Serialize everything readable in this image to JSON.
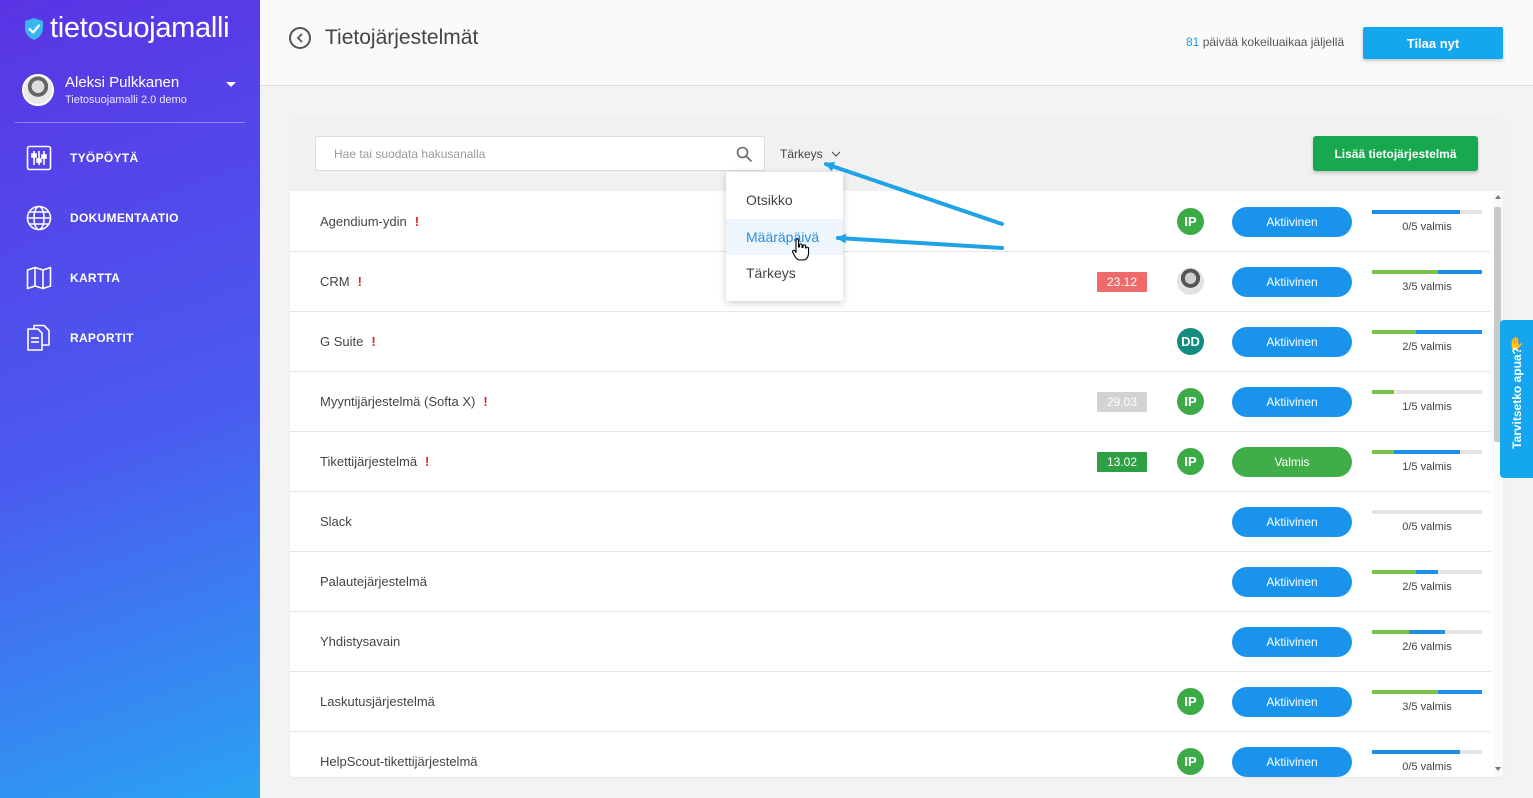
{
  "app": {
    "logo_text": "tietosuojamalli"
  },
  "user": {
    "name": "Aleksi Pulkkanen",
    "org": "Tietosuojamalli 2.0 demo"
  },
  "nav": [
    {
      "label": "TYÖPÖYTÄ",
      "icon": "sliders-icon"
    },
    {
      "label": "DOKUMENTAATIO",
      "icon": "globe-icon"
    },
    {
      "label": "KARTTA",
      "icon": "map-icon"
    },
    {
      "label": "RAPORTIT",
      "icon": "documents-icon"
    }
  ],
  "header": {
    "title": "Tietojärjestelmät",
    "trial_days": "81",
    "trial_text": " päivää kokeiluaikaa jäljellä",
    "order_label": "Tilaa nyt"
  },
  "toolbar": {
    "search_placeholder": "Hae tai suodata hakusanalla",
    "sort_label": "Tärkeys",
    "add_label": "Lisää tietojärjestelmä"
  },
  "dropdown": {
    "options": [
      "Otsikko",
      "Määräpäivä",
      "Tärkeys"
    ],
    "hovered_index": 1
  },
  "colors": {
    "status_active": "#1a93ec",
    "status_done": "#3fae49",
    "date_overdue": "#ef6b6b",
    "date_past": "#d3d3d3",
    "date_ok": "#2ea043",
    "avatar_ip": "#3daa48",
    "avatar_dd": "#128c7e"
  },
  "rows": [
    {
      "name": "Agendium-ydin",
      "important": true,
      "date": "",
      "date_kind": "",
      "assignee": "IP",
      "assignee_kind": "ip",
      "status": "Aktiivinen",
      "status_kind": "active",
      "progress_done": 0,
      "progress_started": 0.8,
      "progress_label": "0/5 valmis"
    },
    {
      "name": "CRM",
      "important": true,
      "date": "23.12",
      "date_kind": "overdue",
      "assignee": "",
      "assignee_kind": "photo",
      "status": "Aktiivinen",
      "status_kind": "active",
      "progress_done": 0.6,
      "progress_started": 1.0,
      "progress_label": "3/5 valmis"
    },
    {
      "name": "G Suite",
      "important": true,
      "date": "",
      "date_kind": "",
      "assignee": "DD",
      "assignee_kind": "dd",
      "status": "Aktiivinen",
      "status_kind": "active",
      "progress_done": 0.4,
      "progress_started": 1.0,
      "progress_label": "2/5 valmis"
    },
    {
      "name": "Myyntijärjestelmä (Softa X)",
      "important": true,
      "date": "29.03",
      "date_kind": "past",
      "assignee": "IP",
      "assignee_kind": "ip",
      "status": "Aktiivinen",
      "status_kind": "active",
      "progress_done": 0.2,
      "progress_started": 0.2,
      "progress_label": "1/5 valmis"
    },
    {
      "name": "Tikettijärjestelmä",
      "important": true,
      "date": "13.02",
      "date_kind": "ok",
      "assignee": "IP",
      "assignee_kind": "ip",
      "status": "Valmis",
      "status_kind": "done",
      "progress_done": 0.2,
      "progress_started": 0.8,
      "progress_label": "1/5 valmis"
    },
    {
      "name": "Slack",
      "important": false,
      "date": "",
      "date_kind": "",
      "assignee": "",
      "assignee_kind": "",
      "status": "Aktiivinen",
      "status_kind": "active",
      "progress_done": 0,
      "progress_started": 0,
      "progress_label": "0/5 valmis"
    },
    {
      "name": "Palautejärjestelmä",
      "important": false,
      "date": "",
      "date_kind": "",
      "assignee": "",
      "assignee_kind": "",
      "status": "Aktiivinen",
      "status_kind": "active",
      "progress_done": 0.4,
      "progress_started": 0.6,
      "progress_label": "2/5 valmis"
    },
    {
      "name": "Yhdistysavain",
      "important": false,
      "date": "",
      "date_kind": "",
      "assignee": "",
      "assignee_kind": "",
      "status": "Aktiivinen",
      "status_kind": "active",
      "progress_done": 0.333,
      "progress_started": 0.667,
      "progress_label": "2/6 valmis"
    },
    {
      "name": "Laskutusjärjestelmä",
      "important": false,
      "date": "",
      "date_kind": "",
      "assignee": "IP",
      "assignee_kind": "ip",
      "status": "Aktiivinen",
      "status_kind": "active",
      "progress_done": 0.6,
      "progress_started": 1.0,
      "progress_label": "3/5 valmis"
    },
    {
      "name": "HelpScout-tikettijärjestelmä",
      "important": false,
      "date": "",
      "date_kind": "",
      "assignee": "IP",
      "assignee_kind": "ip",
      "status": "Aktiivinen",
      "status_kind": "active",
      "progress_done": 0,
      "progress_started": 0.8,
      "progress_label": "0/5 valmis"
    }
  ],
  "help": {
    "label": "Tarvitsetko apua?",
    "icon": "waving-hand-icon"
  }
}
